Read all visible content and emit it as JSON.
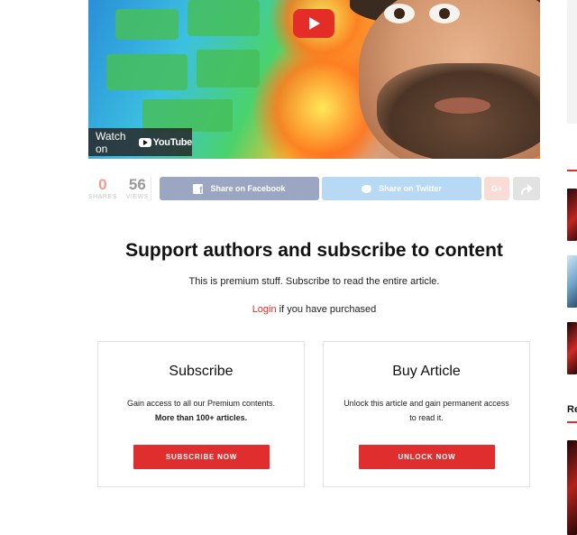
{
  "video": {
    "watch_on_label": "Watch on",
    "platform_label": "YouTube"
  },
  "share_bar": {
    "shares_count": "0",
    "shares_label": "SHARES",
    "views_count": "56",
    "views_label": "VIEWS",
    "facebook_label": "Share on Facebook",
    "twitter_label": "Share on Twitter",
    "googleplus_label": "G+"
  },
  "paywall": {
    "title": "Support authors and subscribe to content",
    "description": "This is premium stuff. Subscribe to read the entire article.",
    "login_link": "Login",
    "login_suffix": " if you have purchased",
    "subscribe_card": {
      "title": "Subscribe",
      "desc_line1": "Gain access to all our Premium contents.",
      "desc_line2": "More than 100+ articles.",
      "button": "SUBSCRIBE NOW"
    },
    "buy_card": {
      "title": "Buy Article",
      "desc": "Unlock this article and gain permanent access to read it.",
      "button": "UNLOCK NOW"
    }
  },
  "sidebar": {
    "heading_fragment": "Re"
  },
  "colors": {
    "accent_red": "#e02d2d",
    "facebook": "#9aa6c2",
    "twitter": "#b7d9f3"
  }
}
